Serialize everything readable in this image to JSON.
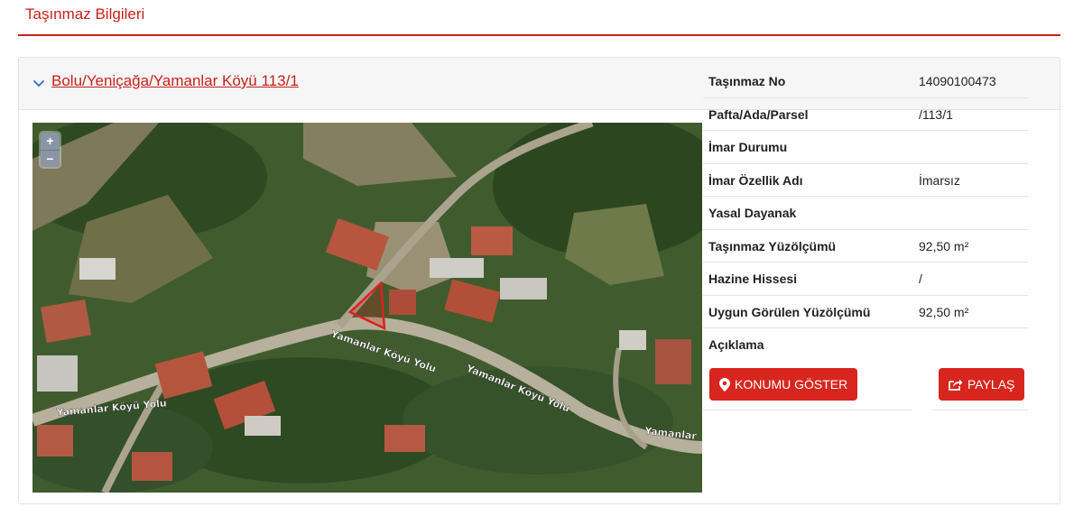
{
  "header": {
    "title": "Taşınmaz Bilgileri"
  },
  "parcel": {
    "link_text": "Bolu/Yeniçağa/Yamanlar Köyü 113/1"
  },
  "map": {
    "zoom_in": "+",
    "zoom_out": "−",
    "road_labels": [
      "Yamanlar Köyü Yolu",
      "Yamanlar Köyü Yolu",
      "Yamanlar Köyü Yolu",
      "Yamanlar"
    ]
  },
  "info": {
    "rows": [
      {
        "label": "Taşınmaz No",
        "value": "14090100473"
      },
      {
        "label": "Pafta/Ada/Parsel",
        "value": "/113/1"
      },
      {
        "label": "İmar Durumu",
        "value": ""
      },
      {
        "label": "İmar Özellik Adı",
        "value": "İmarsız"
      },
      {
        "label": "Yasal Dayanak",
        "value": ""
      },
      {
        "label": "Taşınmaz Yüzölçümü",
        "value": "92,50 m²"
      },
      {
        "label": "Hazine Hissesi",
        "value": "/"
      },
      {
        "label": "Uygun Görülen Yüzölçümü",
        "value": "92,50 m²"
      },
      {
        "label": "Açıklama",
        "value": ""
      }
    ]
  },
  "actions": {
    "show_location": "KONUMU GÖSTER",
    "share": "PAYLAŞ"
  },
  "colors": {
    "accent": "#c8211b",
    "button": "#d8251d"
  }
}
